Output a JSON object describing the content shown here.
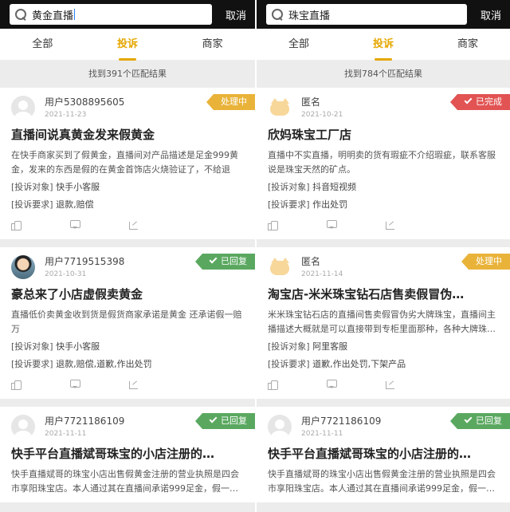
{
  "panes": [
    {
      "search_text": "黄金直播",
      "cancel": "取消",
      "tabs": [
        "全部",
        "投诉",
        "商家"
      ],
      "result_count": "找到391个匹配结果",
      "cards": [
        {
          "username": "用户5308895605",
          "date": "2021-11-23",
          "status": "处理中",
          "title": "直播间说真黄金发来假黄金",
          "desc": "在快手商家买到了假黄金，直播间对产品描述是足金999黄金，发来的东西是假的在黄金首饰店火烧验证了，不给退款…",
          "target_label": "[投诉对象]",
          "target": "快手小客服",
          "demand_label": "[投诉要求]",
          "demand": "退款,赔偿"
        },
        {
          "username": "用户7719515398",
          "date": "2021-10-31",
          "status": "已回复",
          "title": "豪总来了小店虚假卖黄金",
          "desc": "直播低价卖黄金收到货是假货商家承诺是黄金 还承诺假一赔万",
          "target_label": "[投诉对象]",
          "target": "快手小客服",
          "demand_label": "[投诉要求]",
          "demand": "退款,赔偿,道歉,作出处罚"
        },
        {
          "username": "用户7721186109",
          "date": "2021-11-11",
          "status": "已回复",
          "title": "快手平台直播斌哥珠宝的小店注册的…",
          "desc": "快手直播斌哥的珠宝小店出售假黄金注册的营业执照是四会市享阳珠宝店。本人通过其在直播间承诺999足金，假一…",
          "target_label": "",
          "target": "",
          "demand_label": "",
          "demand": ""
        }
      ]
    },
    {
      "search_text": "珠宝直播",
      "cancel": "取消",
      "tabs": [
        "全部",
        "投诉",
        "商家"
      ],
      "result_count": "找到784个匹配结果",
      "cards": [
        {
          "username": "匿名",
          "date": "2021-10-21",
          "status": "已完成",
          "title": "欣妈珠宝工厂店",
          "desc": "直播中不实直播，明明卖的货有瑕疵不介绍瑕疵，联系客服说是珠宝天然的矿点。",
          "target_label": "[投诉对象]",
          "target": "抖音短视频",
          "demand_label": "[投诉要求]",
          "demand": "作出处罚"
        },
        {
          "username": "匿名",
          "date": "2021-11-14",
          "status": "处理中",
          "title": "淘宝店-米米珠宝钻石店售卖假冒伪…",
          "desc": "米米珠宝钻石店的直播间售卖假冒伪劣大牌珠宝，直播间主播描述大概就是可以直接带到专柜里面那种，各种大牌珠…",
          "target_label": "[投诉对象]",
          "target": "阿里客服",
          "demand_label": "[投诉要求]",
          "demand": "道歉,作出处罚,下架产品"
        },
        {
          "username": "用户7721186109",
          "date": "2021-11-11",
          "status": "已回复",
          "title": "快手平台直播斌哥珠宝的小店注册的…",
          "desc": "快手直播斌哥的珠宝小店出售假黄金注册的营业执照是四会市享阳珠宝店。本人通过其在直播间承诺999足金，假一…",
          "target_label": "",
          "target": "",
          "demand_label": "",
          "demand": ""
        }
      ]
    }
  ]
}
